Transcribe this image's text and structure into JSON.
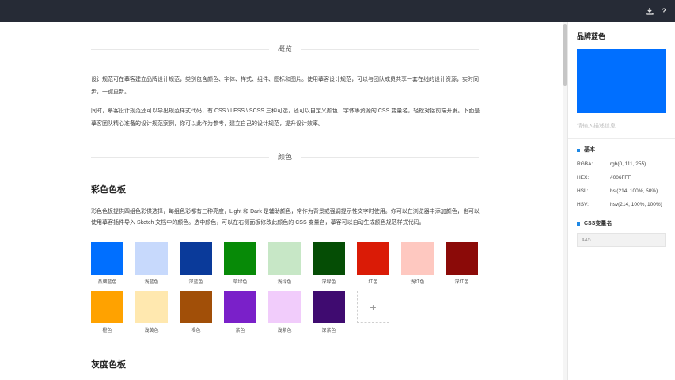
{
  "theme": {
    "topbar": "#262b36",
    "accent": "#1e88e5"
  },
  "topbar": {
    "download_icon": "download-icon",
    "help_glyph": "?"
  },
  "overview": {
    "heading": "概览",
    "paragraphs": [
      "设计规范可在摹客建立品牌设计规范，类别包含颜色、字体、样式、组件、图标和图片。使用摹客设计规范，可以与团队成员共享一套在线的设计资源，实时同步，一键更新。",
      "同时，摹客设计规范还可以导出规范样式代码，有 CSS \\ LESS \\ SCSS 三种可选，还可以自定义颜色，字体等资源的 CSS 变量名，轻松对接前端开发。下面是摹客团队精心准备的设计规范案例，你可以此作为参考，建立自己的设计规范，提升设计效率。"
    ]
  },
  "colors": {
    "heading": "颜色",
    "palette_title": "彩色色板",
    "palette_desc": "彩色色板提供四组色彩供选择，每组色彩都有三种亮度，Light 和 Dark 是辅助颜色，常作为背景或强调提示性文字时使用。你可以在浏览器中添加颜色，也可以使用摹客插件导入 Sketch 文档中的颜色。选中颜色，可以在右侧面板修改此颜色的 CSS 变量名，摹客可以自动生成颜色规范样式代码。",
    "swatches": [
      {
        "label": "品牌蓝色",
        "color": "#006FFF"
      },
      {
        "label": "浅蓝色",
        "color": "#C7D9FC"
      },
      {
        "label": "深蓝色",
        "color": "#0A3A9A"
      },
      {
        "label": "草绿色",
        "color": "#078A07"
      },
      {
        "label": "浅绿色",
        "color": "#C7E7C6"
      },
      {
        "label": "深绿色",
        "color": "#054D05"
      },
      {
        "label": "红色",
        "color": "#DA1B06"
      },
      {
        "label": "浅红色",
        "color": "#FEC8C0"
      },
      {
        "label": "深红色",
        "color": "#8B0A08"
      },
      {
        "label": "橙色",
        "color": "#FFA200"
      },
      {
        "label": "浅黄色",
        "color": "#FFE8AF"
      },
      {
        "label": "褐色",
        "color": "#A14F08"
      },
      {
        "label": "紫色",
        "color": "#7A20C9"
      },
      {
        "label": "浅紫色",
        "color": "#F1CCFB"
      },
      {
        "label": "深紫色",
        "color": "#3F0B70"
      }
    ],
    "add_glyph": "+",
    "gray_title": "灰度色板"
  },
  "panel": {
    "title": "品牌蓝色",
    "color": "#006FFF",
    "description_placeholder": "请输入描述信息",
    "basic_title": "基本",
    "basic": [
      {
        "label": "RGBA:",
        "value": "rgb(0, 111, 255)"
      },
      {
        "label": "HEX:",
        "value": "#006FFF"
      },
      {
        "label": "HSL:",
        "value": "hsl(214, 100%, 50%)"
      },
      {
        "label": "HSV:",
        "value": "hsv(214, 100%, 100%)"
      }
    ],
    "css_var_title": "CSS变量名",
    "css_var_value": "445"
  }
}
